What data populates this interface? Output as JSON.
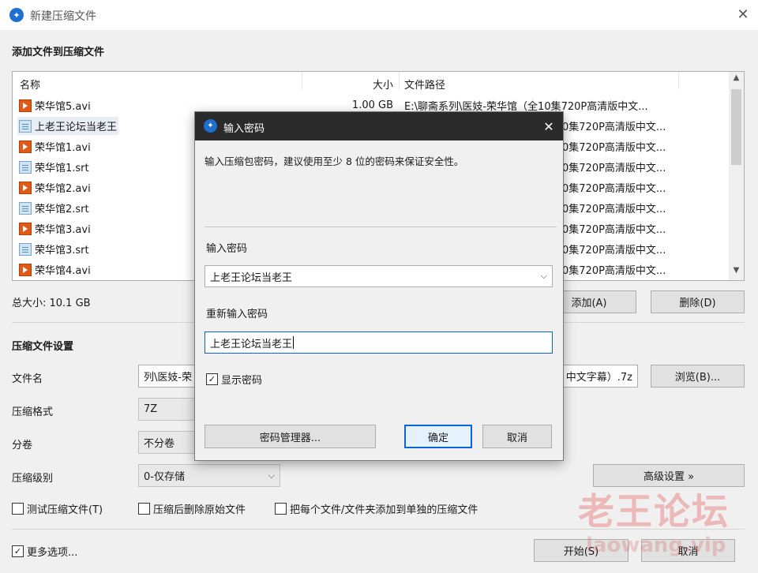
{
  "window": {
    "title": "新建压缩文件"
  },
  "add_section": {
    "title": "添加文件到压缩文件"
  },
  "file_list": {
    "headers": {
      "name": "名称",
      "size": "大小",
      "path": "文件路径"
    },
    "rows": [
      {
        "name": "荣华馆5.avi",
        "type": "avi",
        "size": "1.00 GB",
        "path": "E:\\聊斋系列\\医妓-荣华馆（全10集720P高清版中文..."
      },
      {
        "name": "上老王论坛当老王",
        "type": "srt",
        "size": "",
        "path": "0集720P高清版中文..."
      },
      {
        "name": "荣华馆1.avi",
        "type": "avi",
        "size": "",
        "path": "0集720P高清版中文..."
      },
      {
        "name": "荣华馆1.srt",
        "type": "srt",
        "size": "",
        "path": "0集720P高清版中文..."
      },
      {
        "name": "荣华馆2.avi",
        "type": "avi",
        "size": "",
        "path": "0集720P高清版中文..."
      },
      {
        "name": "荣华馆2.srt",
        "type": "srt",
        "size": "",
        "path": "0集720P高清版中文..."
      },
      {
        "name": "荣华馆3.avi",
        "type": "avi",
        "size": "",
        "path": "0集720P高清版中文..."
      },
      {
        "name": "荣华馆3.srt",
        "type": "srt",
        "size": "",
        "path": "0集720P高清版中文..."
      },
      {
        "name": "荣华馆4.avi",
        "type": "avi",
        "size": "",
        "path": "0集720P高清版中文..."
      }
    ]
  },
  "total_size": "总大小: 10.1 GB",
  "buttons": {
    "add": "添加(A)",
    "delete": "删除(D)",
    "browse": "浏览(B)...",
    "advanced": "高级设置 »",
    "start": "开始(S)",
    "cancel": "取消"
  },
  "settings": {
    "title": "压缩文件设置",
    "filename_label": "文件名",
    "filename_left": "列\\医妓-荣",
    "filename_right": "中文字幕）.7z",
    "format_label": "压缩格式",
    "format_value": "7Z",
    "split_label": "分卷",
    "split_value": "不分卷",
    "level_label": "压缩级别",
    "level_value": "0-仅存储"
  },
  "options": {
    "test": "测试压缩文件(T)",
    "delete_after": "压缩后删除原始文件",
    "each_file": "把每个文件/文件夹添加到单独的压缩文件",
    "more": "更多选项..."
  },
  "dialog": {
    "title": "输入密码",
    "description": "输入压缩包密码，建议使用至少 8 位的密码来保证安全性。",
    "password_label": "输入密码",
    "password_value": "上老王论坛当老王",
    "reenter_label": "重新输入密码",
    "reenter_value": "上老王论坛当老王",
    "show_password": "显示密码",
    "manager_button": "密码管理器...",
    "ok_button": "确定",
    "cancel_button": "取消"
  },
  "watermark": {
    "main": "老王论坛",
    "sub": "laowang.vip"
  }
}
